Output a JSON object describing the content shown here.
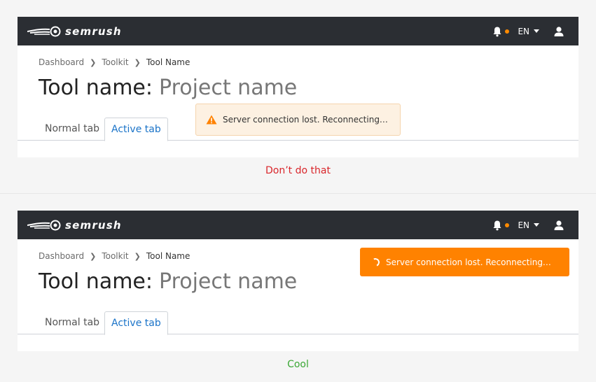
{
  "brand": {
    "name": "semrush"
  },
  "header": {
    "language": "EN"
  },
  "breadcrumb": {
    "items": [
      "Dashboard",
      "Toolkit",
      "Tool Name"
    ]
  },
  "page": {
    "tool_label": "Tool name:",
    "project_label": "Project name"
  },
  "tabs": {
    "normal": "Normal tab",
    "active": "Active tab"
  },
  "notice": {
    "message": "Server connection lost. Reconnecting…"
  },
  "examples": {
    "bad_caption": "Don’t do that",
    "good_caption": "Cool"
  },
  "colors": {
    "topbar": "#2b2e33",
    "accent_orange": "#ff8200",
    "warning_bg": "#fdf1e2",
    "bad": "#d9262b",
    "good": "#3aa734",
    "active_tab": "#1a73c8"
  }
}
